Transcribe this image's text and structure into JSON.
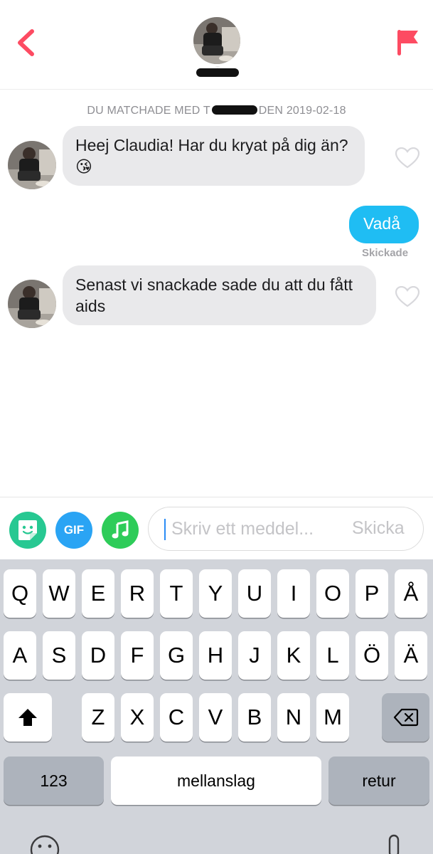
{
  "header": {
    "back_icon": "chevron-left-icon",
    "flag_icon": "flag-icon",
    "accent_color": "#fd4b62",
    "match_name": "T"
  },
  "chat": {
    "match_info": {
      "prefix": "DU MATCHADE MED T",
      "suffix": "DEN 2019-02-18"
    },
    "messages": [
      {
        "direction": "incoming",
        "text": "Heej Claudia! Har du kryat på dig än? 😘",
        "liked": false
      },
      {
        "direction": "outgoing",
        "text": "Vadå",
        "status": "Skickade"
      },
      {
        "direction": "incoming",
        "text": "Senast vi snackade sade du att du fått aids",
        "liked": false
      }
    ],
    "incoming_bubble_color": "#e9e9eb",
    "outgoing_bubble_color": "#1fbdf3"
  },
  "composer": {
    "sticker_icon": "sticker-icon",
    "gif_label": "GIF",
    "music_icon": "music-note-icon",
    "placeholder": "Skriv ett meddel...",
    "value": "",
    "send_label": "Skicka"
  },
  "keyboard": {
    "row1": [
      "Q",
      "W",
      "E",
      "R",
      "T",
      "Y",
      "U",
      "I",
      "O",
      "P",
      "Å"
    ],
    "row2": [
      "A",
      "S",
      "D",
      "F",
      "G",
      "H",
      "J",
      "K",
      "L",
      "Ö",
      "Ä"
    ],
    "row3": [
      "Z",
      "X",
      "C",
      "V",
      "B",
      "N",
      "M"
    ],
    "shift_icon": "shift-icon",
    "delete_icon": "backspace-icon",
    "numbers_label": "123",
    "space_label": "mellanslag",
    "return_label": "retur",
    "emoji_icon": "emoji-icon",
    "mic_icon": "microphone-icon"
  }
}
